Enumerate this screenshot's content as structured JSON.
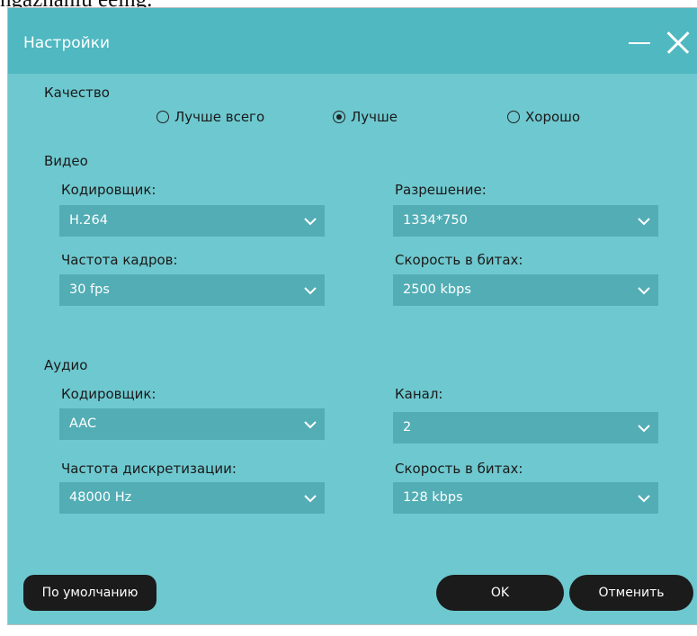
{
  "top_cut_text": "ngaznaniu eeing.",
  "window": {
    "title": "Настройки"
  },
  "quality": {
    "heading": "Качество",
    "options": [
      "Лучше всего",
      "Лучше",
      "Хорошо"
    ],
    "selected": "Лучше"
  },
  "video": {
    "heading": "Видео",
    "encoder": {
      "label": "Кодировщик:",
      "value": "H.264"
    },
    "resolution": {
      "label": "Разрешение:",
      "value": "1334*750"
    },
    "framerate": {
      "label": "Частота кадров:",
      "value": "30 fps"
    },
    "bitrate": {
      "label": "Скорость в битах:",
      "value": "2500 kbps"
    }
  },
  "audio": {
    "heading": "Аудио",
    "encoder": {
      "label": "Кодировщик:",
      "value": "AAC"
    },
    "channel": {
      "label": "Канал:",
      "value": "2"
    },
    "samplerate": {
      "label": "Частота дискретизации:",
      "value": "48000 Hz"
    },
    "bitrate": {
      "label": "Скорость в битах:",
      "value": "128 kbps"
    }
  },
  "buttons": {
    "default": "По умолчанию",
    "ok": "OK",
    "cancel": "Отменить"
  },
  "icons": {
    "minimize": "minimize-icon",
    "close": "close-icon",
    "dropdown": "chevron-down-icon"
  },
  "colors": {
    "titlebar": "#4fb8c1",
    "body": "#6ec8cf",
    "select": "#52adb5",
    "button": "#1b1b1b"
  }
}
